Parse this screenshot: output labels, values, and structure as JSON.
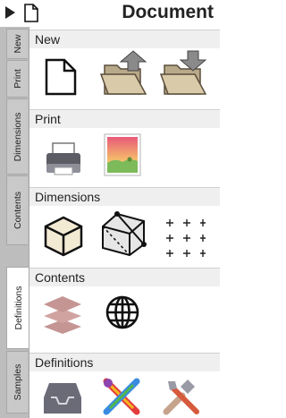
{
  "header": {
    "title": "Document"
  },
  "tabs": [
    "New",
    "Print",
    "Dimensions",
    "Contents",
    "Definitions",
    "Samples"
  ],
  "sections": {
    "new": {
      "title": "New"
    },
    "print": {
      "title": "Print"
    },
    "dimensions": {
      "title": "Dimensions"
    },
    "contents": {
      "title": "Contents"
    },
    "definitions": {
      "title": "Definitions"
    }
  },
  "colors": {
    "tab_strip": "#bdbdbd",
    "active_tab": "#ffffff",
    "section_header": "#efefef"
  }
}
